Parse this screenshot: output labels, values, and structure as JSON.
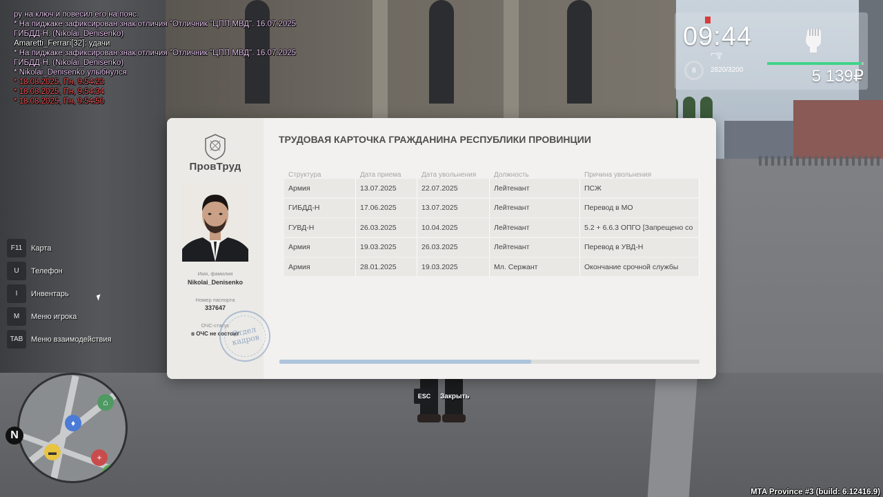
{
  "chat": [
    {
      "text": "ру на ключ и повесил его на пояс.",
      "color": "#e9c8f2"
    },
    {
      "text": " * На пиджаке зафиксирован знак отличия \"Отличник \"ЦПП МВД\". 16.07.2025",
      "color": "#e9c8f2"
    },
    {
      "text": "  ГИБДД-Н. (Nikolai_Denisenko)",
      "color": "#e9c8f2"
    },
    {
      "text": "Amaretti_Ferrari[32]: удачи",
      "color": "#ffffff"
    },
    {
      "text": " * На пиджаке зафиксирован знак отличия \"Отличник \"ЦПП МВД\". 16.07.2025",
      "color": "#e9c8f2"
    },
    {
      "text": "  ГИБДД-Н. (Nikolai_Denisenko)",
      "color": "#e9c8f2"
    },
    {
      "text": " * Nikolai_Denisenko улыбнулся",
      "color": "#e9c8f2"
    },
    {
      "text": " * 18.08.2025, Пн, 9:54:23",
      "color": "#ff5a5a"
    },
    {
      "text": " * 18.08.2025, Пн, 9:54:34",
      "color": "#ff5a5a"
    },
    {
      "text": " * 18.08.2025, Пн, 9:54:50",
      "color": "#ff5a5a"
    }
  ],
  "hud": {
    "time": "09:44",
    "armor": "8",
    "ammo": "2820/3200",
    "money": "5 139₽",
    "health_fraction": 0.98,
    "health_color": "#3fd48a"
  },
  "hotkeys": [
    {
      "key": "F11",
      "label": "Карта"
    },
    {
      "key": "U",
      "label": "Телефон"
    },
    {
      "key": "I",
      "label": "Инвентарь"
    },
    {
      "key": "M",
      "label": "Меню игрока"
    },
    {
      "key": "TAB",
      "label": "Меню взаимодействия"
    }
  ],
  "minimap": {
    "north": "N",
    "icons": [
      "bank-icon",
      "police-icon",
      "taxi-icon",
      "hospital-icon",
      "target-icon"
    ]
  },
  "card": {
    "brand": "ПровТруд",
    "title": "ТРУДОВАЯ КАРТОЧКА ГРАЖДАНИНА РЕСПУБЛИКИ ПРОВИНЦИИ",
    "name_caption": "Имя, фамилия",
    "name": "Nikolai_Denisenko",
    "passport_caption": "Номер паспорта",
    "passport": "337647",
    "ochs_caption": "ОЧС-статус",
    "ochs": "в ОЧС не состоит",
    "stamp_text": "Отдел кадров",
    "scroll_fraction": 0.6,
    "accent": "#aec4dc",
    "columns": [
      "Структура",
      "Дата приема",
      "Дата увольнения",
      "Должность",
      "Причина увольнения"
    ],
    "rows": [
      [
        "Армия",
        "13.07.2025",
        "22.07.2025",
        "Лейтенант",
        "ПСЖ"
      ],
      [
        "ГИБДД-Н",
        "17.06.2025",
        "13.07.2025",
        "Лейтенант",
        "Перевод в МО"
      ],
      [
        "ГУВД-Н",
        "26.03.2025",
        "10.04.2025",
        "Лейтенант",
        "5.2 + 6.6.3 ОПГО [Запрещено со"
      ],
      [
        "Армия",
        "19.03.2025",
        "26.03.2025",
        "Лейтенант",
        "Перевод в УВД-Н"
      ],
      [
        "Армия",
        "28.01.2025",
        "19.03.2025",
        "Мл. Сержант",
        "Окончание срочной службы"
      ]
    ]
  },
  "esc": {
    "key": "ESC",
    "label": "Закрыть"
  },
  "build": "MTA Province #3 (build: 6.12416.9)"
}
